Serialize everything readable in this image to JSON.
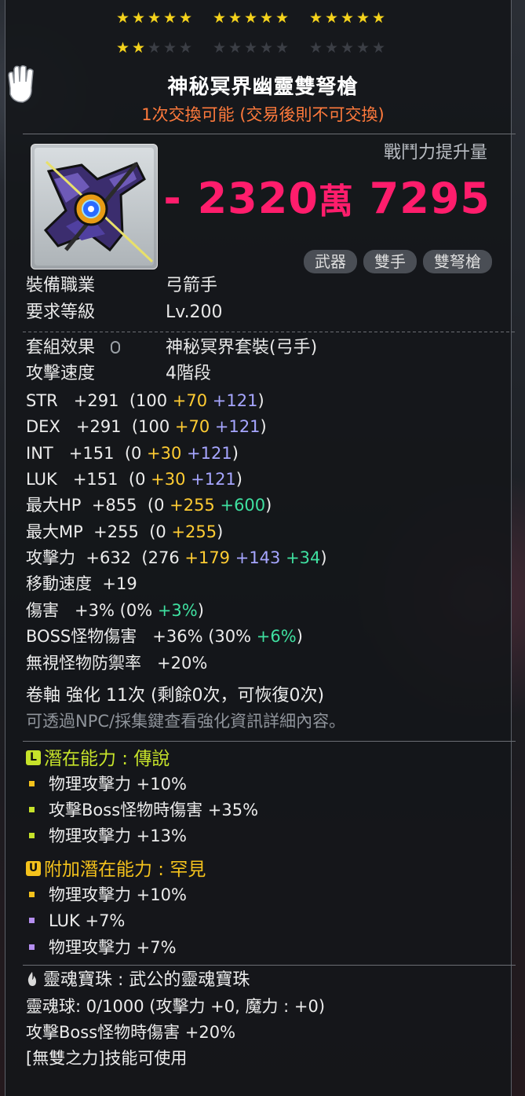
{
  "stars": {
    "row1_filled": 15,
    "row2_filled": 2,
    "row2_total": 15
  },
  "item": {
    "name": "神秘冥界幽靈雙弩槍",
    "trade_note": "1次交換可能 (交易後則不可交換)",
    "combat_power_label": "戰鬥力提升量",
    "combat_power_value_a": "- 2320",
    "combat_power_unit": "萬",
    "combat_power_value_b": " 7295",
    "tags": [
      "武器",
      "雙手",
      "雙弩槍"
    ]
  },
  "info": {
    "job_label": "裝備職業",
    "job_value": "弓箭手",
    "level_label": "要求等級",
    "level_value": "Lv.200",
    "set_label": "套組效果",
    "set_value": "神秘冥界套裝(弓手)",
    "speed_label": "攻擊速度",
    "speed_value": "4階段"
  },
  "stats": [
    {
      "label": "STR",
      "total": "+291",
      "base": "(100 ",
      "flame": "+70",
      "scroll": " +121",
      "green": "",
      "close": ")"
    },
    {
      "label": "DEX",
      "total": "+291",
      "base": "(100 ",
      "flame": "+70",
      "scroll": " +121",
      "green": "",
      "close": ")"
    },
    {
      "label": "INT",
      "total": "+151",
      "base": "(0 ",
      "flame": "+30",
      "scroll": " +121",
      "green": "",
      "close": ")"
    },
    {
      "label": "LUK",
      "total": "+151",
      "base": "(0 ",
      "flame": "+30",
      "scroll": " +121",
      "green": "",
      "close": ")"
    },
    {
      "label": "最大HP",
      "total": "+855",
      "base": "(0 ",
      "flame": "+255",
      "scroll": "",
      "green": " +600",
      "close": ")"
    },
    {
      "label": "最大MP",
      "total": "+255",
      "base": "(0 ",
      "flame": "+255",
      "scroll": "",
      "green": "",
      "close": ")"
    },
    {
      "label": "攻擊力",
      "total": "+632",
      "base": "(276 ",
      "flame": "+179",
      "scroll": " +143",
      "green": " +34",
      "close": ")"
    },
    {
      "label": "移動速度",
      "total": "+19",
      "base": "",
      "flame": "",
      "scroll": "",
      "green": "",
      "close": ""
    },
    {
      "label": "傷害",
      "total": "+3%",
      "base": "(0% ",
      "flame": "",
      "scroll": "",
      "green": "+3%",
      "close": ")"
    },
    {
      "label": "BOSS怪物傷害",
      "total": "+36%",
      "base": "(30% ",
      "flame": "",
      "scroll": "",
      "green": "+6%",
      "close": ")"
    },
    {
      "label": "無視怪物防禦率",
      "total": "+20%",
      "base": "",
      "flame": "",
      "scroll": "",
      "green": "",
      "close": ""
    }
  ],
  "enhance": {
    "line": "卷軸 強化 11次 (剩餘0次，可恢復0次)",
    "hint": "可透過NPC/採集鍵查看強化資訊詳細內容。"
  },
  "potential": {
    "badge": "L",
    "title": "潛在能力 : 傳說",
    "lines": [
      "物理攻擊力 +10%",
      "攻擊Boss怪物時傷害 +35%",
      "物理攻擊力 +13%"
    ],
    "colors": {
      "badge": "#c6e22a",
      "title": "#c6e22a"
    }
  },
  "additional": {
    "badge": "U",
    "title": "附加潛在能力 : 罕見",
    "lines": [
      "物理攻擊力 +10%",
      "LUK +7%",
      "物理攻擊力 +7%"
    ],
    "bullet_colors": [
      "#f4c21c",
      "#b58ef0",
      "#b58ef0"
    ],
    "colors": {
      "badge": "#f4c21c",
      "title": "#f4c21c"
    }
  },
  "soul": {
    "title": "靈魂寶珠 : 武公的靈魂寶珠",
    "line1": "靈魂球: 0/1000 (攻擊力 +0, 魔力 : +0)",
    "line2": "攻擊Boss怪物時傷害 +20%",
    "line3": "[無雙之力]技能可使用"
  }
}
